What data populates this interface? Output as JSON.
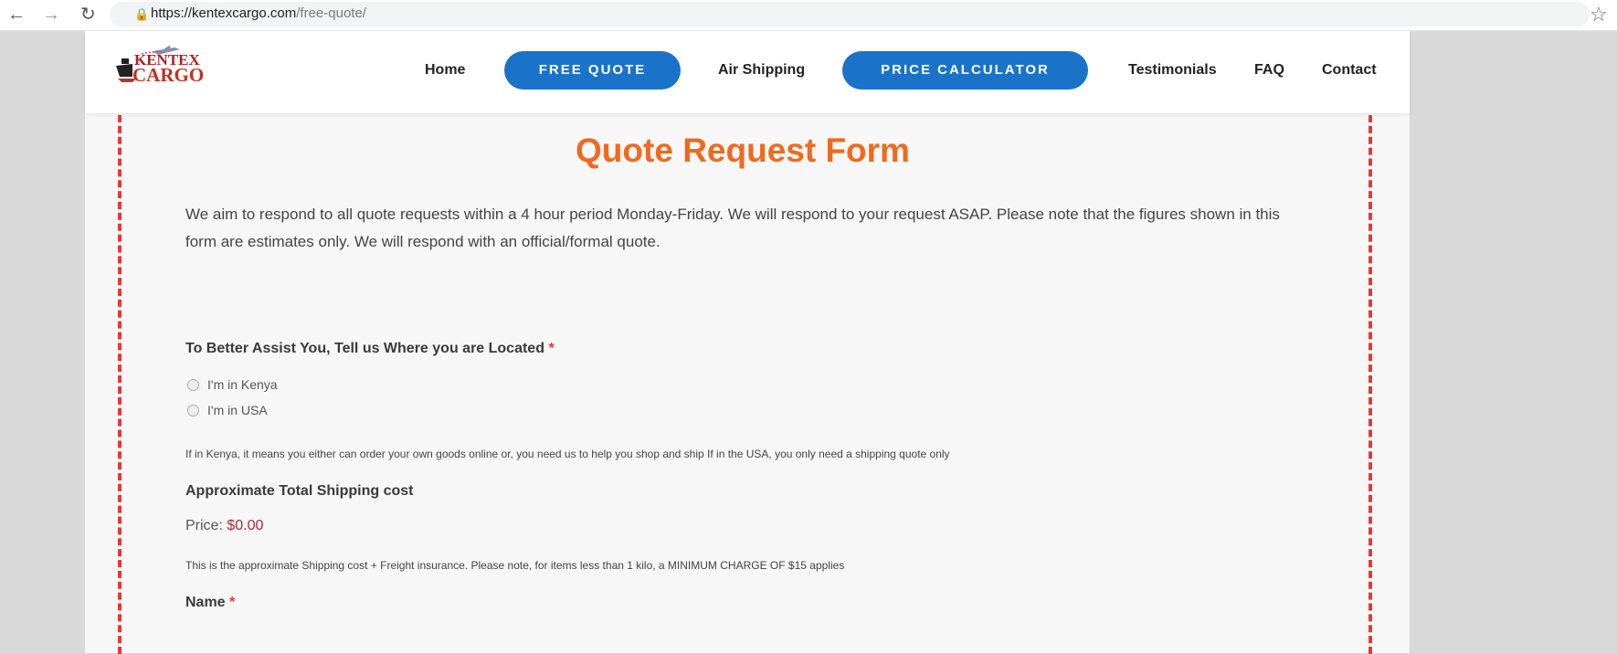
{
  "browser": {
    "url_host": "https://kentexcargo.com",
    "url_path": "/free-quote/"
  },
  "header": {
    "logo_line1": "KENTEX",
    "logo_line2": "CARGO",
    "nav": {
      "home": "Home",
      "free_quote": "FREE QUOTE",
      "air_shipping": "Air Shipping",
      "price_calculator": "PRICE CALCULATOR",
      "testimonials": "Testimonials",
      "faq": "FAQ",
      "contact": "Contact"
    }
  },
  "form": {
    "title": "Quote Request Form",
    "intro": "We aim to respond to all quote requests within a 4 hour period Monday-Friday. We will respond to your request ASAP. Please note that the figures shown in this form are estimates only. We will respond with an official/formal quote.",
    "location_label": "To Better Assist You, Tell us Where you are Located",
    "required_mark": "*",
    "location_options": [
      "I'm in Kenya",
      "I'm in USA"
    ],
    "location_help": "If in Kenya, it means you either can order your own goods online or, you need us to help you shop and ship If in the USA, you only need a shipping quote only",
    "shipping_label": "Approximate Total Shipping cost",
    "price_label": "Price:",
    "price_value": "$0.00",
    "shipping_help": "This is the approximate Shipping cost + Freight insurance. Please note, for items less than 1 kilo, a MINIMUM CHARGE OF $15 applies",
    "name_label": "Name"
  },
  "colors": {
    "accent_orange": "#ef6a1f",
    "pill_blue": "#1a73c8",
    "dash_red": "#e53935",
    "price_red": "#b2292e"
  }
}
